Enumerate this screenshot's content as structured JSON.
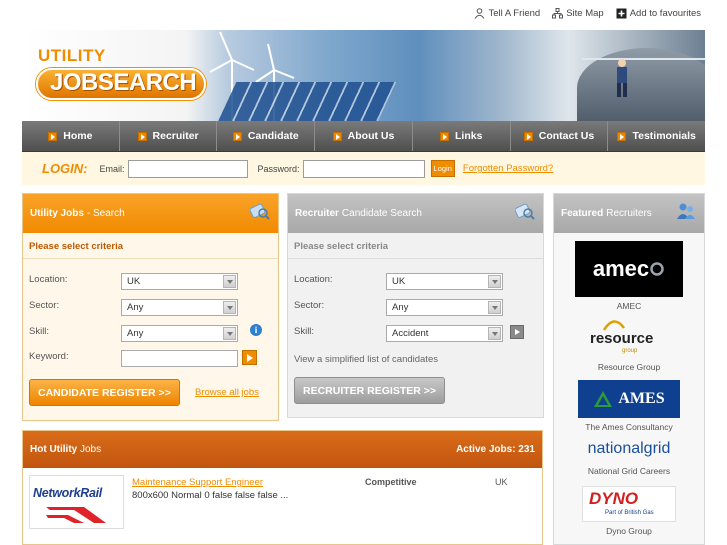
{
  "toplinks": [
    {
      "icon": "person-icon",
      "label": "Tell A Friend"
    },
    {
      "icon": "sitemap-icon",
      "label": "Site Map"
    },
    {
      "icon": "plus-icon",
      "label": "Add to favourites"
    }
  ],
  "logo": {
    "line1": "UTILITY",
    "line2": "JOBSEARCH"
  },
  "nav": [
    {
      "label": "Home"
    },
    {
      "label": "Recruiter"
    },
    {
      "label": "Candidate"
    },
    {
      "label": "About Us"
    },
    {
      "label": "Links"
    },
    {
      "label": "Contact Us"
    },
    {
      "label": "Testimonials"
    }
  ],
  "login": {
    "title": "LOGIN:",
    "email_label": "Email:",
    "email_value": "",
    "password_label": "Password:",
    "password_value": "",
    "button": "Login",
    "forgot": "Forgotten Password?"
  },
  "utility_search": {
    "title_bold": "Utility Jobs",
    "title_rest": "- Search",
    "criteria": "Please select criteria",
    "location_label": "Location:",
    "location_value": "UK",
    "sector_label": "Sector:",
    "sector_value": "Any",
    "skill_label": "Skill:",
    "skill_value": "Any",
    "keyword_label": "Keyword:",
    "keyword_value": "",
    "register_button": "CANDIDATE REGISTER >>",
    "browse_link": "Browse all jobs"
  },
  "recruiter_search": {
    "title_bold": "Recruiter",
    "title_rest": "Candidate Search",
    "criteria": "Please select criteria",
    "location_label": "Location:",
    "location_value": "UK",
    "sector_label": "Sector:",
    "sector_value": "Any",
    "skill_label": "Skill:",
    "skill_value": "Accident",
    "simple_list": "View a simplified list of candidates",
    "register_button": "RECRUITER REGISTER >>"
  },
  "featured": {
    "title_bold": "Featured",
    "title_rest": "Recruiters",
    "items": [
      {
        "logo_text": "amec",
        "caption": "AMEC"
      },
      {
        "logo_text": "resource",
        "logo_sub": "group",
        "caption": "Resource Group"
      },
      {
        "logo_text": "AMES",
        "caption": "The Ames Consultancy"
      },
      {
        "logo_text": "nationalgrid",
        "caption": "National Grid Careers"
      },
      {
        "logo_text": "DYNO",
        "logo_sub": "Part of British Gas",
        "caption": "Dyno Group"
      }
    ]
  },
  "hot_jobs": {
    "title_bold": "Hot Utility",
    "title_rest": "Jobs",
    "active_label": "Active Jobs: 231",
    "jobs": [
      {
        "company_logo": "NetworkRail",
        "title": "Maintenance Support Engineer",
        "description": "800x600 Normal 0 false false false ...",
        "salary": "Competitive",
        "location": "UK"
      }
    ]
  },
  "colors": {
    "accent": "#f08c00",
    "nav": "#5f5f5f",
    "hot_head": "#c95e12",
    "panel_grey": "#b3b3b3"
  }
}
